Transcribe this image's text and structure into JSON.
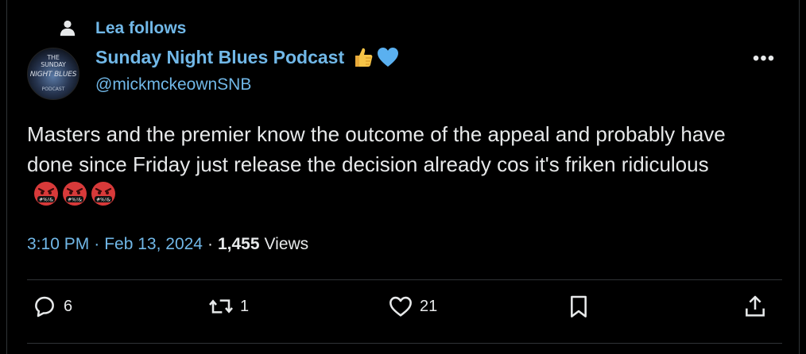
{
  "header": {
    "social_context": "Lea follows"
  },
  "author": {
    "name": "Sunday Night Blues Podcast",
    "handle": "@mickmckeownSNB",
    "avatar_text": [
      "THE",
      "SUNDAY",
      "NIGHT",
      "BLUES",
      "PODCAST"
    ],
    "badges": [
      "thumbs-up-icon",
      "blue-heart-icon"
    ]
  },
  "tweet": {
    "text": "Masters and the premier know the outcome of the appeal and probably have done since Friday just release the decision already cos it's friken ridiculous"
  },
  "meta": {
    "time": "3:10 PM",
    "separator": "·",
    "date": "Feb 13, 2024",
    "views_count": "1,455",
    "views_label": "Views"
  },
  "actions": {
    "replies": "6",
    "retweets": "1",
    "likes": "21"
  },
  "colors": {
    "background": "#000000",
    "link": "#71b8e8",
    "text": "#e7e9ea",
    "divider": "#2f3336"
  }
}
